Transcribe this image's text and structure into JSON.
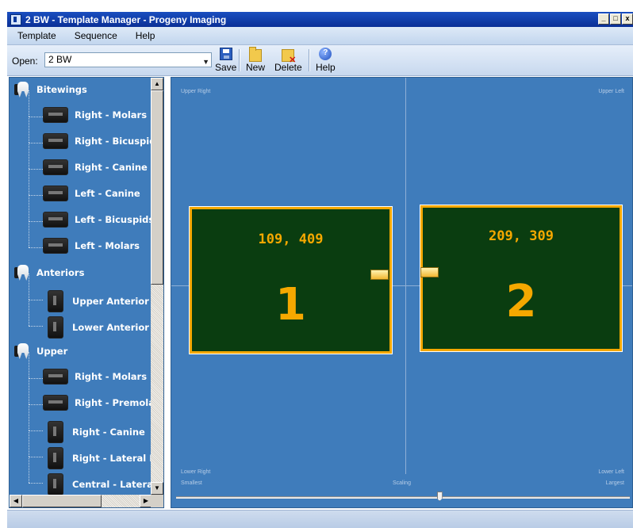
{
  "window": {
    "title": "2 BW - Template Manager - Progeny Imaging",
    "buttons": [
      "_",
      "□",
      "x"
    ]
  },
  "menu": [
    "Template",
    "Sequence",
    "Help"
  ],
  "toolbar": {
    "open_label": "Open:",
    "open_value": "2 BW",
    "save_label": "Save",
    "new_label": "New",
    "delete_label": "Delete",
    "help_label": "Help"
  },
  "tree": {
    "items": [
      {
        "label": "Bitewings",
        "kind": "category"
      },
      {
        "label": "Right - Molars",
        "kind": "sensor-h"
      },
      {
        "label": "Right - Bicuspid",
        "kind": "sensor-h"
      },
      {
        "label": "Right - Canine",
        "kind": "sensor-h"
      },
      {
        "label": "Left - Canine",
        "kind": "sensor-h"
      },
      {
        "label": "Left - Bicuspids",
        "kind": "sensor-h"
      },
      {
        "label": "Left - Molars",
        "kind": "sensor-h"
      },
      {
        "label": "Anteriors",
        "kind": "category"
      },
      {
        "label": "Upper Anterior",
        "kind": "sensor-v"
      },
      {
        "label": "Lower Anterior",
        "kind": "sensor-v"
      },
      {
        "label": "Upper",
        "kind": "category"
      },
      {
        "label": "Right - Molars",
        "kind": "sensor-h"
      },
      {
        "label": "Right - Premola",
        "kind": "sensor-h"
      },
      {
        "label": "Right - Canine",
        "kind": "sensor-v"
      },
      {
        "label": "Right - Lateral I",
        "kind": "sensor-v"
      },
      {
        "label": "Central - Latera",
        "kind": "sensor-v"
      }
    ]
  },
  "canvas": {
    "corners": {
      "upper_right": "Upper Right",
      "upper_left": "Upper Left",
      "lower_right": "Lower Right",
      "lower_left": "Lower Left"
    },
    "slider": {
      "smallest": "Smallest",
      "scaling": "Scaling",
      "largest": "Largest",
      "value_fraction": 0.58
    },
    "templates": [
      {
        "number": "1",
        "coords": "109, 409"
      },
      {
        "number": "2",
        "coords": "209, 309"
      }
    ]
  },
  "colors": {
    "panel_bg": "#3f7cbb",
    "template_fill": "#0a3d10",
    "template_accent": "#f5a800"
  }
}
